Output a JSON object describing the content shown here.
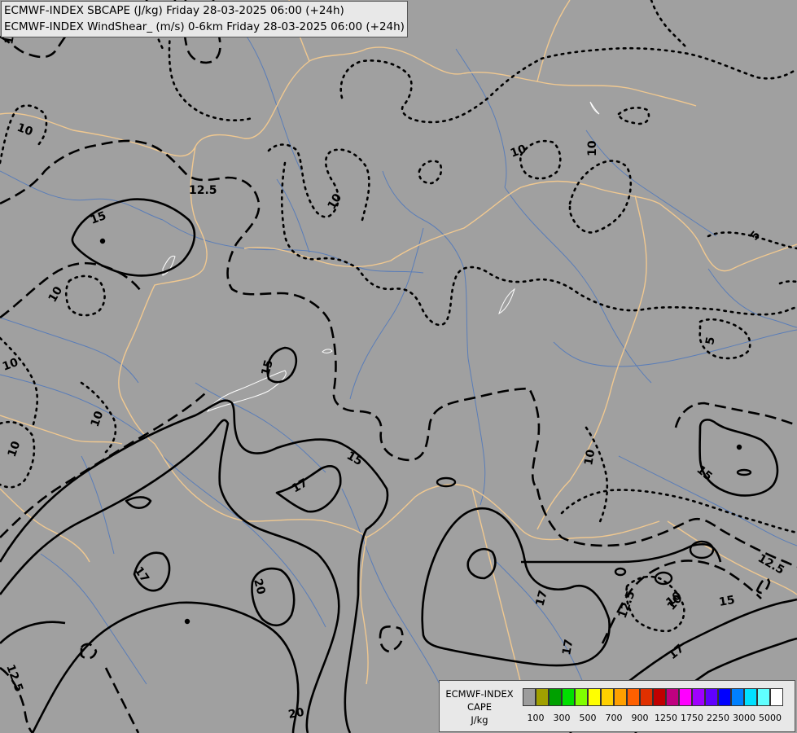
{
  "header": {
    "line1": "ECMWF-INDEX SBCAPE (J/kg) Friday 28-03-2025 06:00 (+24h)",
    "line2": "ECMWF-INDEX WindShear_ (m/s) 0-6km Friday 28-03-2025 06:00 (+24h)"
  },
  "legend": {
    "title1": "ECMWF-INDEX",
    "title2": "CAPE",
    "unit": "J/kg",
    "colors": [
      "#9c9c9c",
      "#a0a000",
      "#00a000",
      "#00e000",
      "#80ff00",
      "#ffff00",
      "#ffd000",
      "#ffa000",
      "#ff6000",
      "#e03000",
      "#c00000",
      "#c00080",
      "#ff00ff",
      "#a000ff",
      "#6000ff",
      "#0000ff",
      "#0080ff",
      "#00e0ff",
      "#60ffff",
      "#ffffff"
    ],
    "ticks": [
      "100",
      "300",
      "500",
      "700",
      "900",
      "1250",
      "1750",
      "2250",
      "3000",
      "5000"
    ]
  },
  "contour_labels": [
    {
      "text": "12.5",
      "name": "label-12-5-a"
    },
    {
      "text": "10",
      "name": "label-10-a"
    },
    {
      "text": "10",
      "name": "label-10-b"
    },
    {
      "text": "10",
      "name": "label-10-c"
    },
    {
      "text": "10",
      "name": "label-10-d"
    },
    {
      "text": "12.5",
      "name": "label-12-5-b"
    },
    {
      "text": "15",
      "name": "label-15-a"
    },
    {
      "text": "10",
      "name": "label-10-e"
    },
    {
      "text": "10",
      "name": "label-10-f"
    },
    {
      "text": "10",
      "name": "label-10-g"
    },
    {
      "text": "10",
      "name": "label-10-h"
    },
    {
      "text": "10",
      "name": "label-10-i"
    },
    {
      "text": "10",
      "name": "label-10-j"
    },
    {
      "text": "5",
      "name": "label-5-a"
    },
    {
      "text": "5",
      "name": "label-5-b"
    },
    {
      "text": "15",
      "name": "label-15-b"
    },
    {
      "text": "17",
      "name": "label-17-a"
    },
    {
      "text": "15",
      "name": "label-15-c"
    },
    {
      "text": "10",
      "name": "label-10-k"
    },
    {
      "text": "15",
      "name": "label-15-d"
    },
    {
      "text": "12.5",
      "name": "label-12-5-c"
    },
    {
      "text": "17",
      "name": "label-17-b"
    },
    {
      "text": "20",
      "name": "label-20-a"
    },
    {
      "text": "17",
      "name": "label-17-c"
    },
    {
      "text": "12.5",
      "name": "label-12-5-d"
    },
    {
      "text": "10",
      "name": "label-10-l"
    },
    {
      "text": "15",
      "name": "label-15-e"
    },
    {
      "text": "17",
      "name": "label-17-d"
    },
    {
      "text": "17",
      "name": "label-17-e"
    },
    {
      "text": "12.5",
      "name": "label-12-5-e"
    },
    {
      "text": "20",
      "name": "label-20-b"
    }
  ]
}
